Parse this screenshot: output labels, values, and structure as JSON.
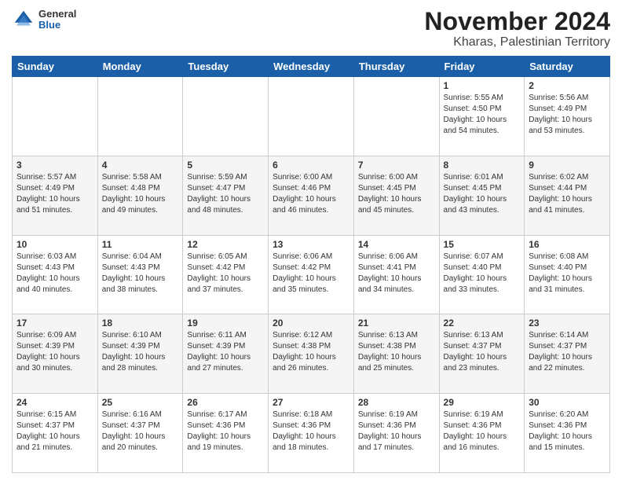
{
  "logo": {
    "general": "General",
    "blue": "Blue"
  },
  "title": "November 2024",
  "subtitle": "Kharas, Palestinian Territory",
  "days_of_week": [
    "Sunday",
    "Monday",
    "Tuesday",
    "Wednesday",
    "Thursday",
    "Friday",
    "Saturday"
  ],
  "weeks": [
    [
      {
        "day": "",
        "info": ""
      },
      {
        "day": "",
        "info": ""
      },
      {
        "day": "",
        "info": ""
      },
      {
        "day": "",
        "info": ""
      },
      {
        "day": "",
        "info": ""
      },
      {
        "day": "1",
        "info": "Sunrise: 5:55 AM\nSunset: 4:50 PM\nDaylight: 10 hours and 54 minutes."
      },
      {
        "day": "2",
        "info": "Sunrise: 5:56 AM\nSunset: 4:49 PM\nDaylight: 10 hours and 53 minutes."
      }
    ],
    [
      {
        "day": "3",
        "info": "Sunrise: 5:57 AM\nSunset: 4:49 PM\nDaylight: 10 hours and 51 minutes."
      },
      {
        "day": "4",
        "info": "Sunrise: 5:58 AM\nSunset: 4:48 PM\nDaylight: 10 hours and 49 minutes."
      },
      {
        "day": "5",
        "info": "Sunrise: 5:59 AM\nSunset: 4:47 PM\nDaylight: 10 hours and 48 minutes."
      },
      {
        "day": "6",
        "info": "Sunrise: 6:00 AM\nSunset: 4:46 PM\nDaylight: 10 hours and 46 minutes."
      },
      {
        "day": "7",
        "info": "Sunrise: 6:00 AM\nSunset: 4:45 PM\nDaylight: 10 hours and 45 minutes."
      },
      {
        "day": "8",
        "info": "Sunrise: 6:01 AM\nSunset: 4:45 PM\nDaylight: 10 hours and 43 minutes."
      },
      {
        "day": "9",
        "info": "Sunrise: 6:02 AM\nSunset: 4:44 PM\nDaylight: 10 hours and 41 minutes."
      }
    ],
    [
      {
        "day": "10",
        "info": "Sunrise: 6:03 AM\nSunset: 4:43 PM\nDaylight: 10 hours and 40 minutes."
      },
      {
        "day": "11",
        "info": "Sunrise: 6:04 AM\nSunset: 4:43 PM\nDaylight: 10 hours and 38 minutes."
      },
      {
        "day": "12",
        "info": "Sunrise: 6:05 AM\nSunset: 4:42 PM\nDaylight: 10 hours and 37 minutes."
      },
      {
        "day": "13",
        "info": "Sunrise: 6:06 AM\nSunset: 4:42 PM\nDaylight: 10 hours and 35 minutes."
      },
      {
        "day": "14",
        "info": "Sunrise: 6:06 AM\nSunset: 4:41 PM\nDaylight: 10 hours and 34 minutes."
      },
      {
        "day": "15",
        "info": "Sunrise: 6:07 AM\nSunset: 4:40 PM\nDaylight: 10 hours and 33 minutes."
      },
      {
        "day": "16",
        "info": "Sunrise: 6:08 AM\nSunset: 4:40 PM\nDaylight: 10 hours and 31 minutes."
      }
    ],
    [
      {
        "day": "17",
        "info": "Sunrise: 6:09 AM\nSunset: 4:39 PM\nDaylight: 10 hours and 30 minutes."
      },
      {
        "day": "18",
        "info": "Sunrise: 6:10 AM\nSunset: 4:39 PM\nDaylight: 10 hours and 28 minutes."
      },
      {
        "day": "19",
        "info": "Sunrise: 6:11 AM\nSunset: 4:39 PM\nDaylight: 10 hours and 27 minutes."
      },
      {
        "day": "20",
        "info": "Sunrise: 6:12 AM\nSunset: 4:38 PM\nDaylight: 10 hours and 26 minutes."
      },
      {
        "day": "21",
        "info": "Sunrise: 6:13 AM\nSunset: 4:38 PM\nDaylight: 10 hours and 25 minutes."
      },
      {
        "day": "22",
        "info": "Sunrise: 6:13 AM\nSunset: 4:37 PM\nDaylight: 10 hours and 23 minutes."
      },
      {
        "day": "23",
        "info": "Sunrise: 6:14 AM\nSunset: 4:37 PM\nDaylight: 10 hours and 22 minutes."
      }
    ],
    [
      {
        "day": "24",
        "info": "Sunrise: 6:15 AM\nSunset: 4:37 PM\nDaylight: 10 hours and 21 minutes."
      },
      {
        "day": "25",
        "info": "Sunrise: 6:16 AM\nSunset: 4:37 PM\nDaylight: 10 hours and 20 minutes."
      },
      {
        "day": "26",
        "info": "Sunrise: 6:17 AM\nSunset: 4:36 PM\nDaylight: 10 hours and 19 minutes."
      },
      {
        "day": "27",
        "info": "Sunrise: 6:18 AM\nSunset: 4:36 PM\nDaylight: 10 hours and 18 minutes."
      },
      {
        "day": "28",
        "info": "Sunrise: 6:19 AM\nSunset: 4:36 PM\nDaylight: 10 hours and 17 minutes."
      },
      {
        "day": "29",
        "info": "Sunrise: 6:19 AM\nSunset: 4:36 PM\nDaylight: 10 hours and 16 minutes."
      },
      {
        "day": "30",
        "info": "Sunrise: 6:20 AM\nSunset: 4:36 PM\nDaylight: 10 hours and 15 minutes."
      }
    ]
  ]
}
